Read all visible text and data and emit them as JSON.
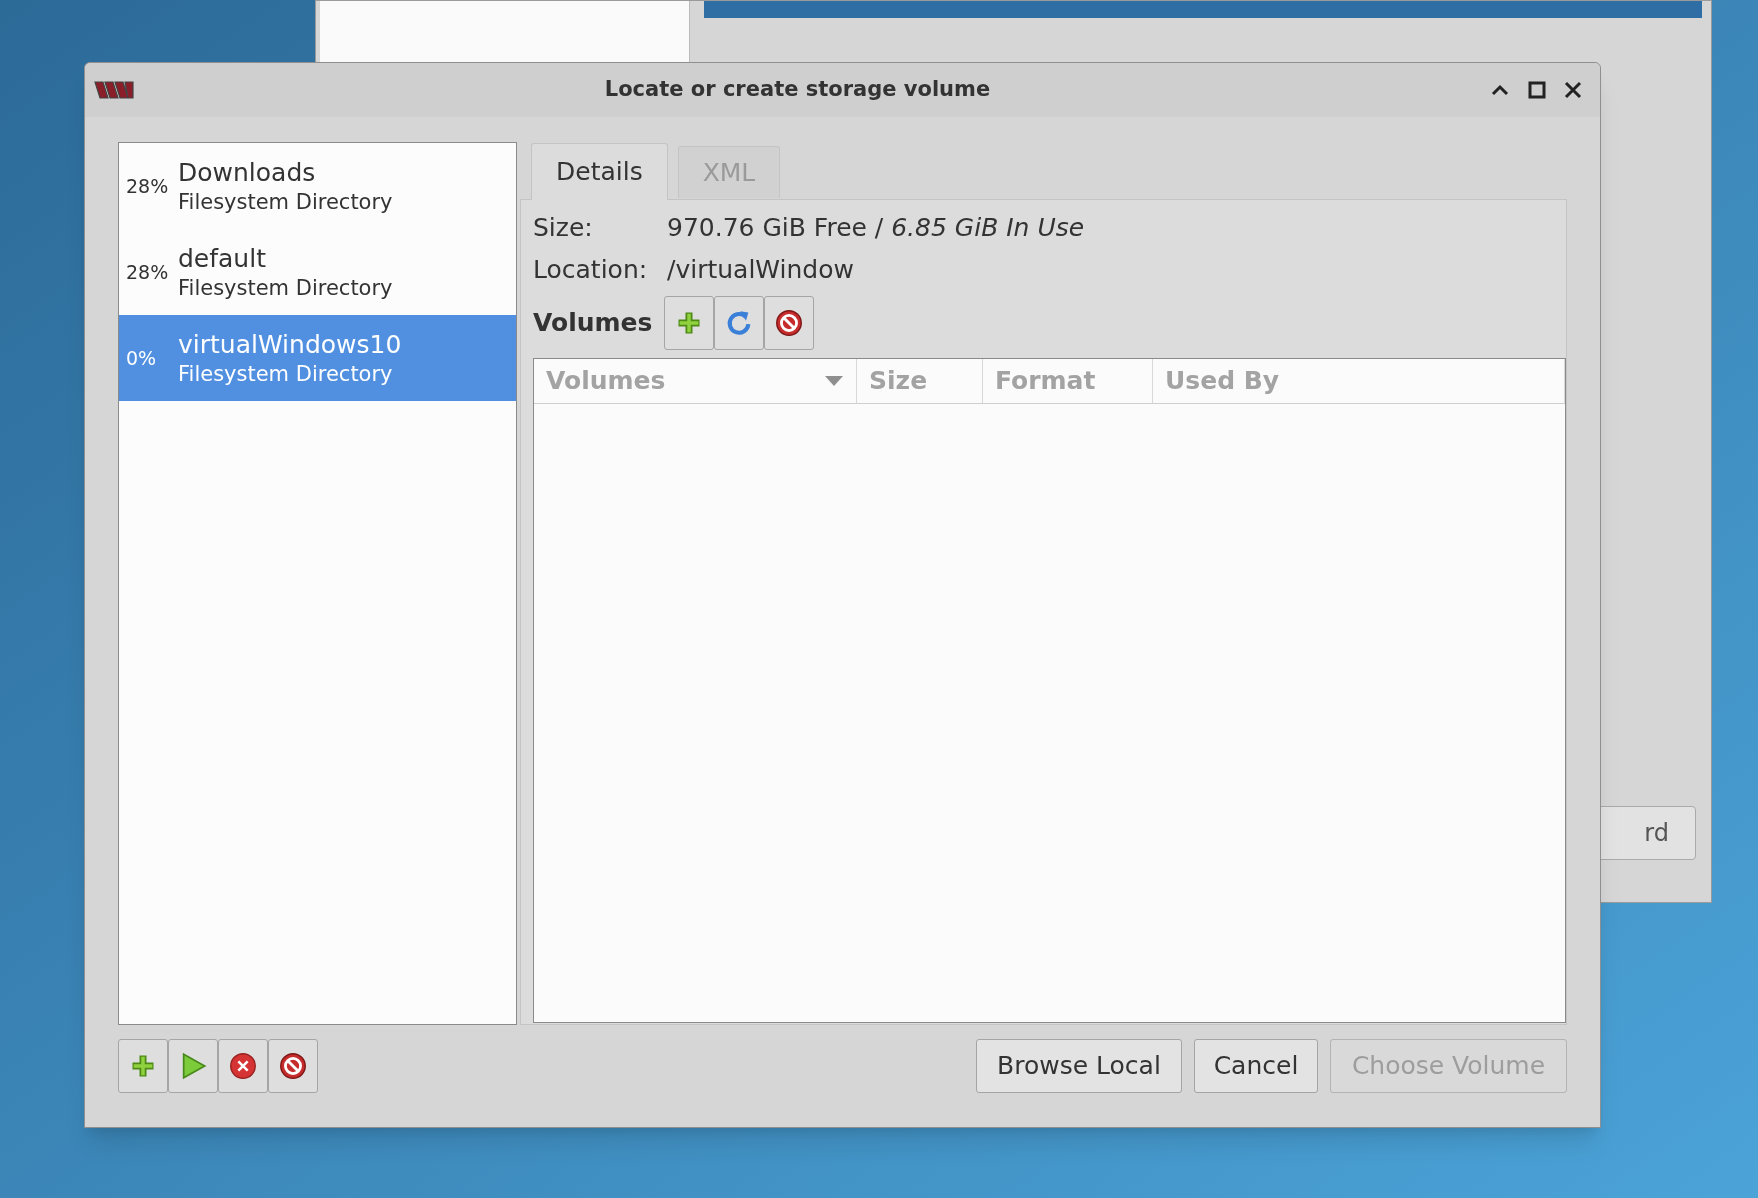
{
  "background_window": {
    "button_label": "rd"
  },
  "dialog": {
    "title": "Locate or create storage volume"
  },
  "pools": [
    {
      "usage": "28%",
      "name": "Downloads",
      "type": "Filesystem Directory",
      "selected": false
    },
    {
      "usage": "28%",
      "name": "default",
      "type": "Filesystem Directory",
      "selected": false
    },
    {
      "usage": "0%",
      "name": "virtualWindows10",
      "type": "Filesystem Directory",
      "selected": true
    }
  ],
  "pool_buttons": [
    {
      "kind": "add"
    },
    {
      "kind": "start"
    },
    {
      "kind": "stop"
    },
    {
      "kind": "delete"
    }
  ],
  "tabs": [
    {
      "label": "Details",
      "selected": true
    },
    {
      "label": "XML",
      "selected": false
    }
  ],
  "details": {
    "size_label": "Size:",
    "size_value": "970.76 GiB Free / *6.85 GiB In Use*",
    "location_label": "Location:",
    "location_value": "/virtualWindow"
  },
  "volumes_label": "Volumes",
  "volume_buttons": [
    {
      "kind": "add"
    },
    {
      "kind": "refresh"
    },
    {
      "kind": "delete"
    }
  ],
  "volume_table": {
    "columns": [
      {
        "label": "Volumes",
        "sorted": true
      },
      {
        "label": "Size",
        "sorted": false
      },
      {
        "label": "Format",
        "sorted": false
      },
      {
        "label": "Used By",
        "sorted": false
      }
    ]
  },
  "buttons": [
    {
      "label": "Browse Local",
      "disabled": false
    },
    {
      "label": "Cancel",
      "disabled": false
    },
    {
      "label": "Choose Volume",
      "disabled": true
    }
  ]
}
